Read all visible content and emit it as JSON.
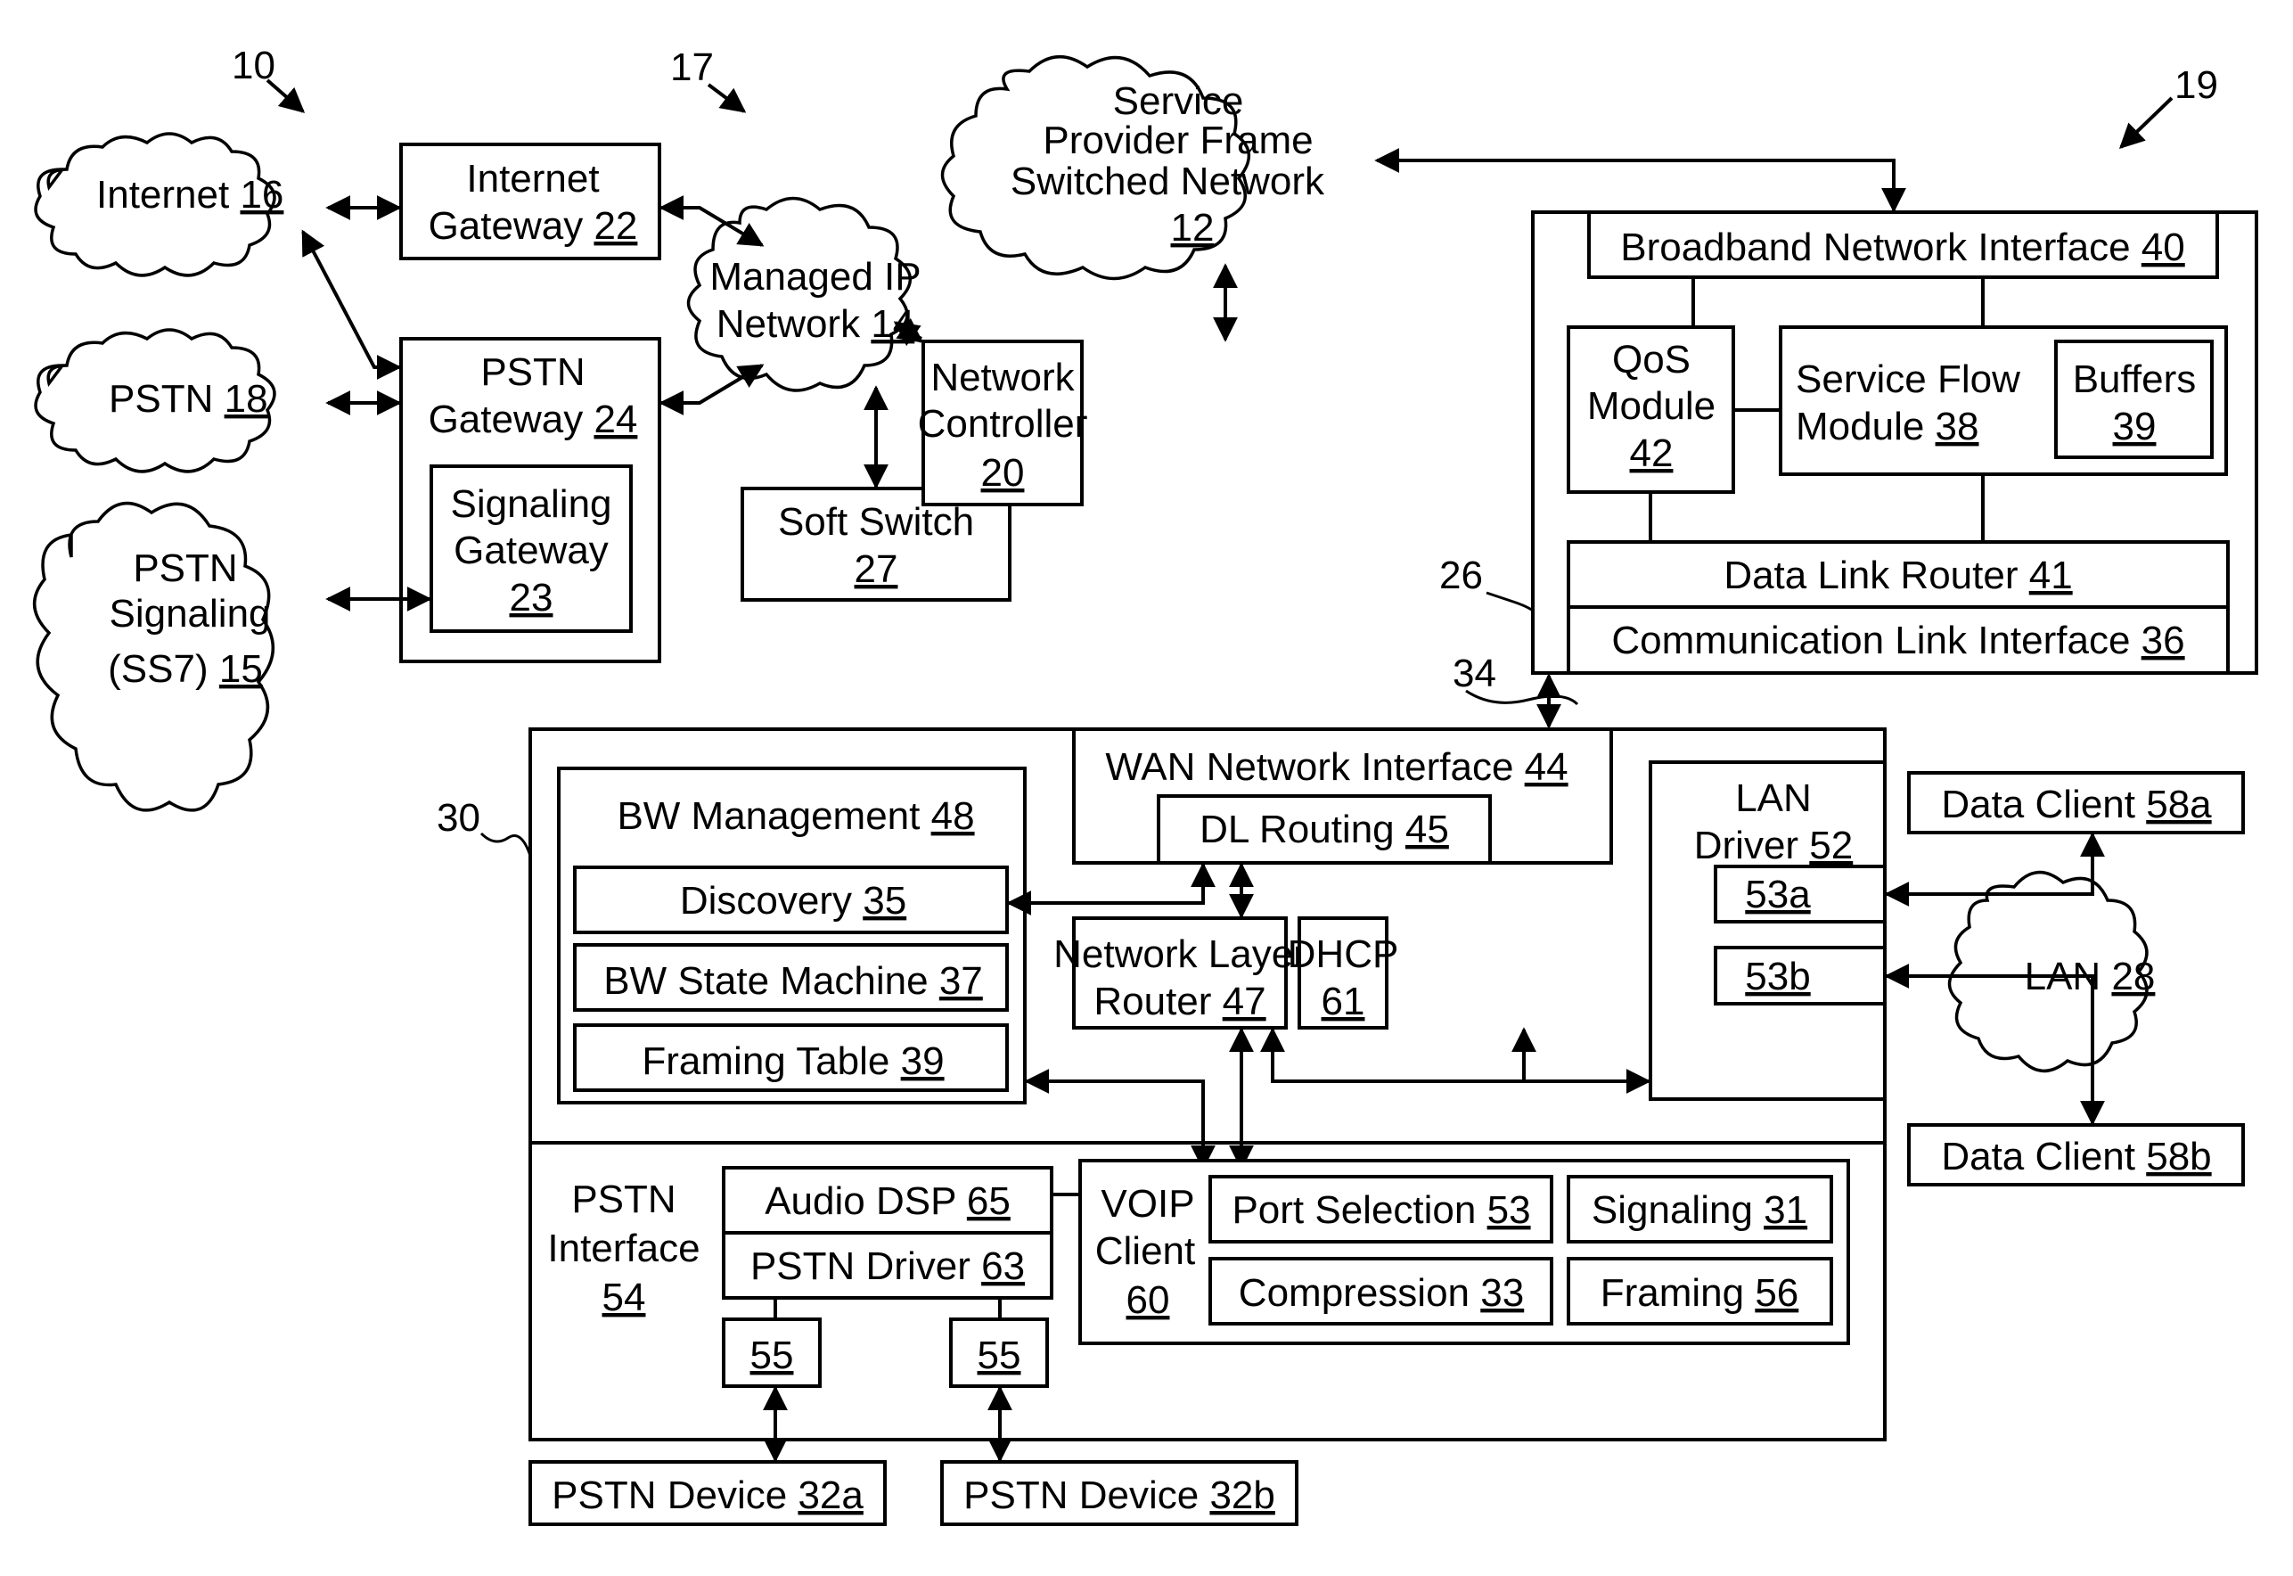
{
  "figure_refs": {
    "system": "10",
    "ip_network": "17",
    "broadband_system": "19",
    "service_provider_equipment": "26",
    "communication_link": "34",
    "access_device": "30"
  },
  "clouds": {
    "internet": {
      "label": "Internet",
      "ref": "16"
    },
    "pstn": {
      "label": "PSTN",
      "ref": "18"
    },
    "pstn_signaling": {
      "line1": "PSTN",
      "line2": "Signaling",
      "line3": "(SS7)",
      "ref": "15"
    },
    "managed_ip": {
      "line1": "Managed IP",
      "line2": "Network",
      "ref": "14"
    },
    "service_provider": {
      "line1": "Service",
      "line2": "Provider Frame",
      "line3": "Switched Network",
      "ref": "12"
    },
    "lan": {
      "label": "LAN",
      "ref": "28"
    }
  },
  "blocks": {
    "internet_gateway": {
      "line1": "Internet",
      "line2": "Gateway",
      "ref": "22"
    },
    "pstn_gateway": {
      "line1": "PSTN",
      "line2": "Gateway",
      "ref": "24"
    },
    "signaling_gateway": {
      "line1": "Signaling",
      "line2": "Gateway",
      "ref": "23"
    },
    "soft_switch": {
      "line1": "Soft Switch",
      "ref": "27"
    },
    "network_controller": {
      "line1": "Network",
      "line2": "Controller",
      "ref": "20"
    },
    "broadband_network_interface": {
      "label": "Broadband Network Interface",
      "ref": "40"
    },
    "qos_module": {
      "line1": "QoS",
      "line2": "Module",
      "ref": "42"
    },
    "service_flow_module": {
      "line1": "Service Flow",
      "line2": "Module",
      "ref": "38"
    },
    "buffers": {
      "line1": "Buffers",
      "ref": "39"
    },
    "data_link_router": {
      "label": "Data Link Router",
      "ref": "41"
    },
    "communication_link_interface": {
      "label": "Communication Link Interface",
      "ref": "36"
    },
    "bw_management": {
      "label": "BW Management",
      "ref": "48"
    },
    "discovery": {
      "label": "Discovery",
      "ref": "35"
    },
    "bw_state_machine": {
      "label": "BW State Machine",
      "ref": "37"
    },
    "framing_table": {
      "label": "Framing Table",
      "ref": "39"
    },
    "wan_network_interface": {
      "label": "WAN Network Interface",
      "ref": "44"
    },
    "dl_routing": {
      "label": "DL Routing",
      "ref": "45"
    },
    "network_layer_router": {
      "line1": "Network Layer",
      "line2": "Router",
      "ref": "47"
    },
    "dhcp": {
      "line1": "DHCP",
      "ref": "61"
    },
    "lan_driver": {
      "line1": "LAN",
      "line2": "Driver",
      "ref": "52"
    },
    "port_53a": {
      "ref": "53a"
    },
    "port_53b": {
      "ref": "53b"
    },
    "data_client_a": {
      "label": "Data Client",
      "ref": "58a"
    },
    "data_client_b": {
      "label": "Data Client",
      "ref": "58b"
    },
    "pstn_interface": {
      "line1": "PSTN",
      "line2": "Interface",
      "ref": "54"
    },
    "audio_dsp": {
      "label": "Audio DSP",
      "ref": "65"
    },
    "pstn_driver": {
      "label": "PSTN Driver",
      "ref": "63"
    },
    "port_55_a": {
      "ref": "55"
    },
    "port_55_b": {
      "ref": "55"
    },
    "voip_client": {
      "line1": "VOIP",
      "line2": "Client",
      "ref": "60"
    },
    "port_selection": {
      "label": "Port Selection",
      "ref": "53"
    },
    "signaling": {
      "label": "Signaling",
      "ref": "31"
    },
    "compression": {
      "label": "Compression",
      "ref": "33"
    },
    "framing": {
      "label": "Framing",
      "ref": "56"
    },
    "pstn_device_a": {
      "label": "PSTN Device",
      "ref": "32a"
    },
    "pstn_device_b": {
      "label": "PSTN Device",
      "ref": "32b"
    }
  }
}
